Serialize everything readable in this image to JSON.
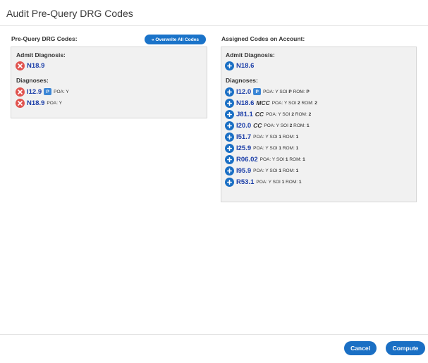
{
  "dialog": {
    "title": "Audit Pre-Query DRG Codes"
  },
  "left": {
    "heading": "Pre-Query DRG Codes:",
    "overwrite_label": "« Overwrite All Codes",
    "admit_label": "Admit Diagnosis:",
    "admit_code": "N18.9",
    "diagnoses_label": "Diagnoses:",
    "diagnoses": [
      {
        "code": "I12.9",
        "badge": "P",
        "cc": "",
        "meta": "POA: Y"
      },
      {
        "code": "N18.9",
        "badge": "",
        "cc": "",
        "meta": "POA: Y"
      }
    ]
  },
  "right": {
    "heading": "Assigned Codes on Account:",
    "admit_label": "Admit Diagnosis:",
    "admit_code": "N18.6",
    "diagnoses_label": "Diagnoses:",
    "diagnoses": [
      {
        "code": "I12.0",
        "badge": "P",
        "cc": "",
        "poa": "POA: Y",
        "soi_label": "SOI",
        "soi": "P",
        "rom_label": "ROM:",
        "rom": "P"
      },
      {
        "code": "N18.6",
        "badge": "",
        "cc": "MCC",
        "poa": "POA: Y",
        "soi_label": "SOI",
        "soi": "2",
        "rom_label": "ROM:",
        "rom": "2"
      },
      {
        "code": "J81.1",
        "badge": "",
        "cc": "CC",
        "poa": "POA: Y",
        "soi_label": "SOI",
        "soi": "2",
        "rom_label": "ROM:",
        "rom": "2"
      },
      {
        "code": "I20.0",
        "badge": "",
        "cc": "CC",
        "poa": "POA: Y",
        "soi_label": "SOI",
        "soi": "2",
        "rom_label": "ROM:",
        "rom": "1"
      },
      {
        "code": "I51.7",
        "badge": "",
        "cc": "",
        "poa": "POA: Y",
        "soi_label": "SOI",
        "soi": "1",
        "rom_label": "ROM:",
        "rom": "1"
      },
      {
        "code": "I25.9",
        "badge": "",
        "cc": "",
        "poa": "POA: Y",
        "soi_label": "SOI",
        "soi": "1",
        "rom_label": "ROM:",
        "rom": "1"
      },
      {
        "code": "R06.02",
        "badge": "",
        "cc": "",
        "poa": "POA: Y",
        "soi_label": "SOI",
        "soi": "1",
        "rom_label": "ROM:",
        "rom": "1"
      },
      {
        "code": "I95.9",
        "badge": "",
        "cc": "",
        "poa": "POA: Y",
        "soi_label": "SOI",
        "soi": "1",
        "rom_label": "ROM:",
        "rom": "1"
      },
      {
        "code": "R53.1",
        "badge": "",
        "cc": "",
        "poa": "POA: Y",
        "soi_label": "SOI",
        "soi": "1",
        "rom_label": "ROM:",
        "rom": "1"
      }
    ]
  },
  "footer": {
    "cancel_label": "Cancel",
    "compute_label": "Compute"
  },
  "icons": {
    "remove": "remove-circle-icon",
    "add": "add-circle-icon"
  },
  "colors": {
    "primary": "#1a6fc4",
    "remove": "#e0524e",
    "code_text": "#1b3ea8",
    "badge": "#3b86d6"
  }
}
